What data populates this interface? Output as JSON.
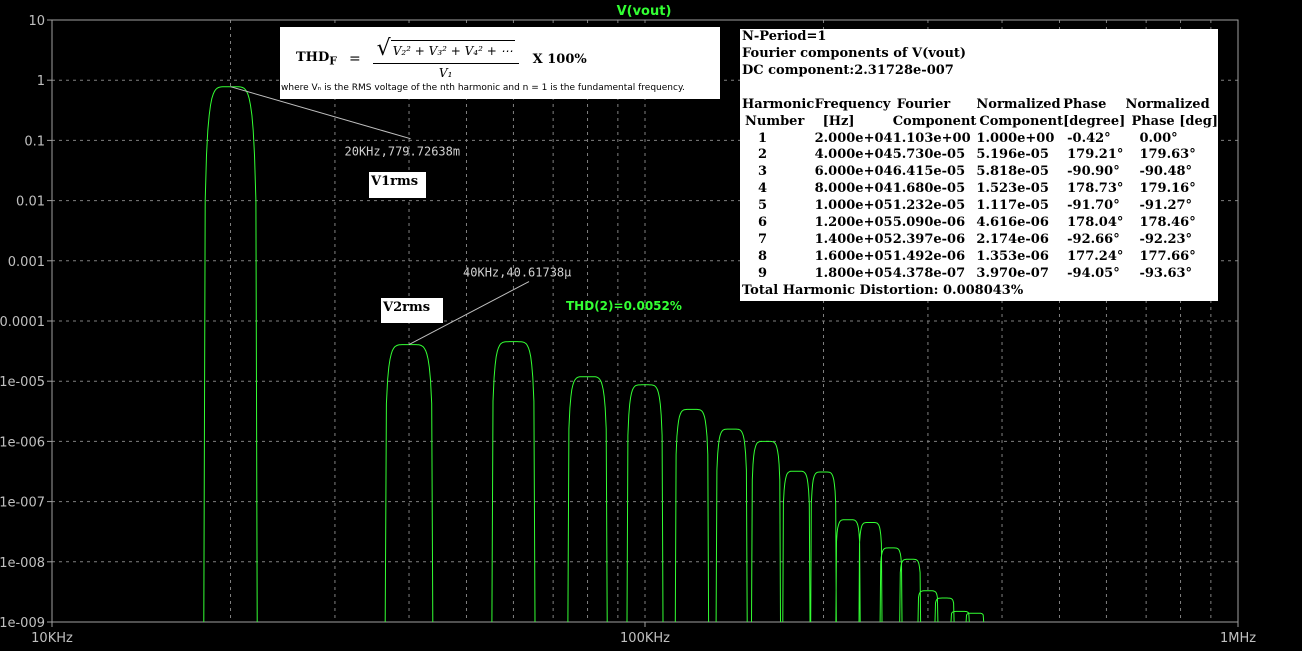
{
  "chart_data": {
    "type": "line",
    "title": "V(vout)",
    "x_scale": "log",
    "y_scale": "log",
    "xlim": [
      10000,
      1000000
    ],
    "ylim": [
      1e-09,
      10
    ],
    "x_tick_labels": [
      "10KHz",
      "100KHz",
      "1MHz"
    ],
    "x_tick_values": [
      10000,
      100000,
      1000000
    ],
    "y_tick_labels": [
      "10",
      "1",
      "0.1",
      "0.01",
      "0.001",
      "0.0001",
      "1e-005",
      "1e-006",
      "1e-007",
      "1e-008",
      "1e-009"
    ],
    "y_tick_values": [
      10,
      1,
      0.1,
      0.01,
      0.001,
      0.0001,
      1e-05,
      1e-06,
      1e-07,
      1e-08,
      1e-09
    ],
    "grid": true,
    "series_color": "#33ff33",
    "series": [
      {
        "peaks": [
          {
            "f": 20000,
            "v": 0.7797
          },
          {
            "f": 40000,
            "v": 4.06e-05
          },
          {
            "f": 60000,
            "v": 4.54e-05
          },
          {
            "f": 80000,
            "v": 1.19e-05
          },
          {
            "f": 100000,
            "v": 8.7e-06
          },
          {
            "f": 120000,
            "v": 3.4e-06
          },
          {
            "f": 140000,
            "v": 1.6e-06
          },
          {
            "f": 160000,
            "v": 1e-06
          },
          {
            "f": 180000,
            "v": 3.2e-07
          },
          {
            "f": 200000,
            "v": 3.1e-07
          },
          {
            "f": 220000,
            "v": 5e-08
          },
          {
            "f": 240000,
            "v": 4.5e-08
          },
          {
            "f": 260000,
            "v": 1.7e-08
          },
          {
            "f": 280000,
            "v": 1.1e-08
          },
          {
            "f": 300000,
            "v": 3.3e-09
          },
          {
            "f": 320000,
            "v": 2.5e-09
          },
          {
            "f": 340000,
            "v": 1.5e-09
          },
          {
            "f": 360000,
            "v": 1.4e-09
          }
        ]
      }
    ],
    "annotations": [
      {
        "text": "20KHz,779.72638m",
        "f": 20000,
        "v": 0.7797
      },
      {
        "text": "40KHz,40.61738µ",
        "f": 40000,
        "v": 4.06e-05
      }
    ],
    "thd_label": "THD(2)=0.0052%"
  },
  "labels": {
    "v1rms": "V1rms",
    "v2rms": "V2rms"
  },
  "formula": {
    "lhs": "THD",
    "lhs_sub": "F",
    "numerator": "V₂² + V₃² + V₄² + ⋯",
    "denominator": "V₁",
    "multiplier": "X 100%",
    "note": "where Vₙ is the RMS voltage of the nth harmonic and n = 1 is the fundamental frequency."
  },
  "fourier": {
    "n_period": "N-Period=1",
    "title": "Fourier components of V(vout)",
    "dc": "DC component:2.31728e-007",
    "headers_1": [
      "Harmonic",
      "Frequency",
      "Fourier",
      "Normalized",
      "Phase",
      "Normalized"
    ],
    "headers_2": [
      "Number",
      "[Hz]",
      "Component",
      "Component",
      "[degree]",
      "Phase [deg]"
    ],
    "rows": [
      [
        "1",
        "2.000e+04",
        "1.103e+00",
        "1.000e+00",
        "-0.42°",
        "0.00°"
      ],
      [
        "2",
        "4.000e+04",
        "5.730e-05",
        "5.196e-05",
        "179.21°",
        "179.63°"
      ],
      [
        "3",
        "6.000e+04",
        "6.415e-05",
        "5.818e-05",
        "-90.90°",
        "-90.48°"
      ],
      [
        "4",
        "8.000e+04",
        "1.680e-05",
        "1.523e-05",
        "178.73°",
        "179.16°"
      ],
      [
        "5",
        "1.000e+05",
        "1.232e-05",
        "1.117e-05",
        "-91.70°",
        "-91.27°"
      ],
      [
        "6",
        "1.200e+05",
        "5.090e-06",
        "4.616e-06",
        "178.04°",
        "178.46°"
      ],
      [
        "7",
        "1.400e+05",
        "2.397e-06",
        "2.174e-06",
        "-92.66°",
        "-92.23°"
      ],
      [
        "8",
        "1.600e+05",
        "1.492e-06",
        "1.353e-06",
        "177.24°",
        "177.66°"
      ],
      [
        "9",
        "1.800e+05",
        "4.378e-07",
        "3.970e-07",
        "-94.05°",
        "-93.63°"
      ]
    ],
    "thd": "Total Harmonic Distortion: 0.008043%"
  }
}
